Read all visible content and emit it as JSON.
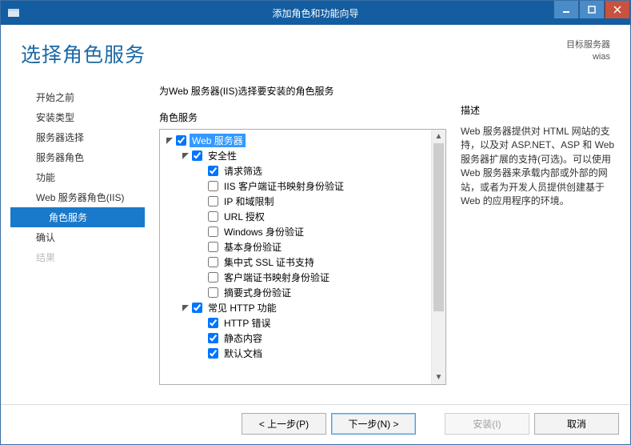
{
  "window": {
    "title": "添加角色和功能向导"
  },
  "header": {
    "page_title": "选择角色服务",
    "target_label": "目标服务器",
    "target_name": "wias"
  },
  "sidebar": {
    "items": [
      {
        "label": "开始之前",
        "selected": false,
        "indent": false,
        "disabled": false
      },
      {
        "label": "安装类型",
        "selected": false,
        "indent": false,
        "disabled": false
      },
      {
        "label": "服务器选择",
        "selected": false,
        "indent": false,
        "disabled": false
      },
      {
        "label": "服务器角色",
        "selected": false,
        "indent": false,
        "disabled": false
      },
      {
        "label": "功能",
        "selected": false,
        "indent": false,
        "disabled": false
      },
      {
        "label": "Web 服务器角色(IIS)",
        "selected": false,
        "indent": false,
        "disabled": false
      },
      {
        "label": "角色服务",
        "selected": true,
        "indent": true,
        "disabled": false
      },
      {
        "label": "确认",
        "selected": false,
        "indent": false,
        "disabled": false
      },
      {
        "label": "结果",
        "selected": false,
        "indent": false,
        "disabled": true
      }
    ]
  },
  "center": {
    "instruction": "为Web 服务器(IIS)选择要安装的角色服务",
    "section_label": "角色服务"
  },
  "tree": [
    {
      "depth": 0,
      "expanded": true,
      "checked": true,
      "label": "Web 服务器",
      "selected": true
    },
    {
      "depth": 1,
      "expanded": true,
      "checked": true,
      "label": "安全性"
    },
    {
      "depth": 2,
      "expanded": null,
      "checked": true,
      "label": "请求筛选"
    },
    {
      "depth": 2,
      "expanded": null,
      "checked": false,
      "label": "IIS 客户端证书映射身份验证"
    },
    {
      "depth": 2,
      "expanded": null,
      "checked": false,
      "label": "IP 和域限制"
    },
    {
      "depth": 2,
      "expanded": null,
      "checked": false,
      "label": "URL 授权"
    },
    {
      "depth": 2,
      "expanded": null,
      "checked": false,
      "label": "Windows 身份验证"
    },
    {
      "depth": 2,
      "expanded": null,
      "checked": false,
      "label": "基本身份验证"
    },
    {
      "depth": 2,
      "expanded": null,
      "checked": false,
      "label": "集中式 SSL 证书支持"
    },
    {
      "depth": 2,
      "expanded": null,
      "checked": false,
      "label": "客户端证书映射身份验证"
    },
    {
      "depth": 2,
      "expanded": null,
      "checked": false,
      "label": "摘要式身份验证"
    },
    {
      "depth": 1,
      "expanded": true,
      "checked": true,
      "label": "常见 HTTP 功能"
    },
    {
      "depth": 2,
      "expanded": null,
      "checked": true,
      "label": "HTTP 错误"
    },
    {
      "depth": 2,
      "expanded": null,
      "checked": true,
      "label": "静态内容"
    },
    {
      "depth": 2,
      "expanded": null,
      "checked": true,
      "label": "默认文档"
    }
  ],
  "desc": {
    "title": "描述",
    "text": "Web 服务器提供对 HTML 网站的支持，以及对 ASP.NET、ASP 和 Web 服务器扩展的支持(可选)。可以使用 Web 服务器来承载内部或外部的网站，或者为开发人员提供创建基于 Web 的应用程序的环境。"
  },
  "footer": {
    "prev": "< 上一步(P)",
    "next": "下一步(N) >",
    "install": "安装(I)",
    "cancel": "取消"
  }
}
